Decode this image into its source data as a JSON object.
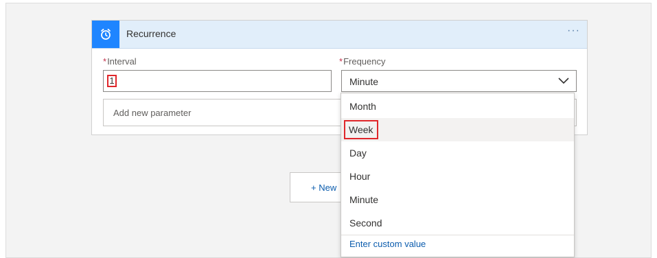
{
  "card": {
    "title": "Recurrence",
    "more_label": "···",
    "icon": "alarm-clock-icon",
    "accent": "#1f85ff"
  },
  "interval": {
    "required_mark": "*",
    "label": "Interval",
    "value": "1"
  },
  "frequency": {
    "required_mark": "*",
    "label": "Frequency",
    "value": "Minute",
    "icon": "chevron-down-icon",
    "options": [
      "Month",
      "Week",
      "Day",
      "Hour",
      "Minute",
      "Second"
    ],
    "highlighted": "Week",
    "custom_label": "Enter custom value"
  },
  "add_parameter": {
    "placeholder": "Add new parameter"
  },
  "new_step": {
    "label": "+ New"
  }
}
